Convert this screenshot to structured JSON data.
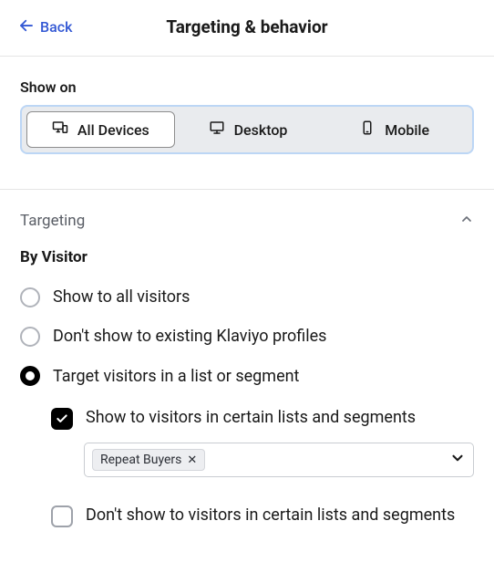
{
  "header": {
    "back_label": "Back",
    "title": "Targeting & behavior"
  },
  "show_on": {
    "label": "Show on",
    "options": {
      "all": "All Devices",
      "desktop": "Desktop",
      "mobile": "Mobile"
    }
  },
  "targeting": {
    "title": "Targeting",
    "by_visitor_label": "By Visitor",
    "radio_all": "Show to all visitors",
    "radio_no_existing": "Don't show to existing Klaviyo profiles",
    "radio_list_segment": "Target visitors in a list or segment",
    "show_in_lists_label": "Show to visitors in certain lists and segments",
    "dont_show_in_lists_label": "Don't show to visitors in certain lists and segments",
    "selected_chip": "Repeat Buyers"
  }
}
